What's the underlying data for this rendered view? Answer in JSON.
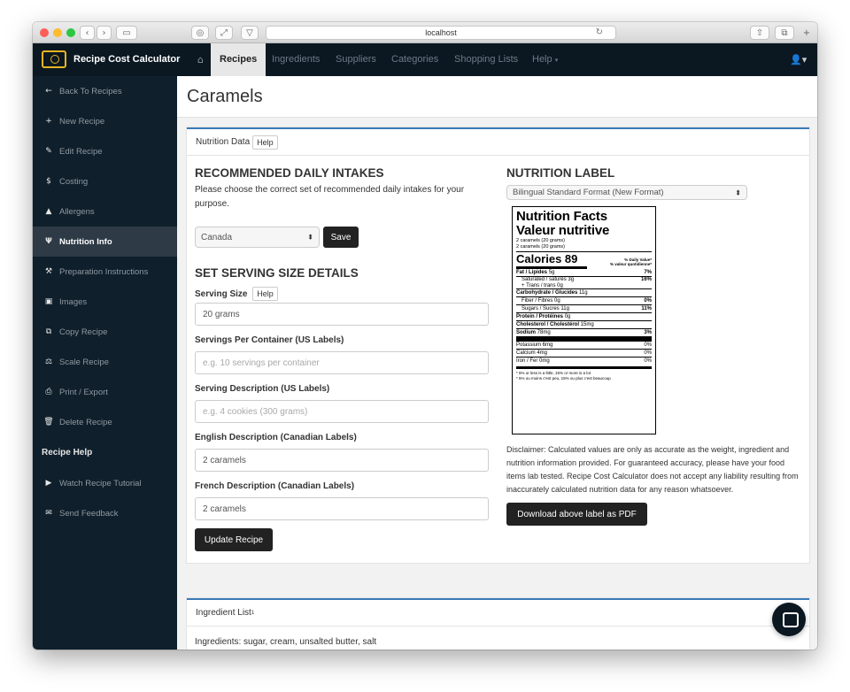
{
  "browser": {
    "url": "localhost"
  },
  "app": {
    "brand": "Recipe Cost Calculator",
    "nav": [
      "Recipes",
      "Ingredients",
      "Suppliers",
      "Categories",
      "Shopping Lists",
      "Help"
    ],
    "user_icon": "user-icon"
  },
  "sidebar": {
    "items": [
      {
        "icon": "←",
        "label": "Back To Recipes"
      },
      {
        "icon": "+",
        "label": "New Recipe"
      },
      {
        "icon": "✎",
        "label": "Edit Recipe"
      },
      {
        "icon": "$",
        "label": "Costing"
      },
      {
        "icon": "▲",
        "label": "Allergens"
      },
      {
        "icon": "Ψ",
        "label": "Nutrition Info"
      },
      {
        "icon": "⚒",
        "label": "Preparation Instructions"
      },
      {
        "icon": "▣",
        "label": "Images"
      },
      {
        "icon": "⧉",
        "label": "Copy Recipe"
      },
      {
        "icon": "⚖",
        "label": "Scale Recipe"
      },
      {
        "icon": "⎙",
        "label": "Print / Export"
      },
      {
        "icon": "🗑",
        "label": "Delete Recipe"
      }
    ],
    "help_heading": "Recipe Help",
    "help_items": [
      {
        "icon": "▶",
        "label": "Watch Recipe Tutorial"
      },
      {
        "icon": "✉",
        "label": "Send Feedback"
      }
    ]
  },
  "page": {
    "title": "Caramels",
    "panel_title": "Nutrition Data",
    "help": "Help",
    "rdi": {
      "heading": "RECOMMENDED DAILY INTAKES",
      "text": "Please choose the correct set of recommended daily intakes for your purpose.",
      "country": "Canada",
      "save": "Save"
    },
    "serving": {
      "heading": "SET SERVING SIZE DETAILS",
      "size_label": "Serving Size",
      "size_value": "20 grams",
      "per_container_label": "Servings Per Container (US Labels)",
      "per_container_ph": "e.g. 10 servings per container",
      "desc_label": "Serving Description (US Labels)",
      "desc_ph": "e.g. 4 cookies (300 grams)",
      "en_label": "English Description (Canadian Labels)",
      "en_value": "2 caramels",
      "fr_label": "French Description (Canadian Labels)",
      "fr_value": "2 caramels",
      "update": "Update Recipe"
    },
    "label_section": {
      "heading": "NUTRITION LABEL",
      "format": "Bilingual Standard Format (New Format)",
      "disclaimer": "Disclaimer: Calculated values are only as accurate as the weight, ingredient and nutrition information provided. For guaranteed accuracy, please have your food items lab tested. Recipe Cost Calculator does not accept any liability resulting from inaccurately calculated nutrition data for any reason whatsoever.",
      "download": "Download above label as PDF"
    },
    "ingredients": {
      "title": "Ingredient List",
      "sup": "1",
      "text": "Ingredients: sugar, cream, unsalted butter, salt"
    }
  },
  "nutrition_facts": {
    "title_en": "Nutrition Facts",
    "title_fr": "Valeur nutritive",
    "serving1": "2 caramels (20 grams)",
    "serving2": "2 caramels (20 grams)",
    "calories": "Calories 89",
    "dv_en": "% Daily Value*",
    "dv_fr": "% valeur quotidienne*",
    "rows": [
      {
        "l": "Fat / Lipides",
        "v": "5g",
        "r": "7%"
      },
      {
        "l": "Saturated / saturés 3g",
        "sub": "+ Trans / trans 0g",
        "r": "16%"
      },
      {
        "l": "Carbohydrate / Glucides",
        "v": "11g",
        "r": ""
      },
      {
        "l": "Fiber / Fibres 0g",
        "r": "0%"
      },
      {
        "l": "Sugars / Sucres 11g",
        "r": "11%"
      },
      {
        "l": "Protein / Protéines",
        "v": "0g",
        "r": ""
      },
      {
        "l": "Cholesterol / Cholestérol",
        "v": "15mg",
        "r": ""
      },
      {
        "l": "Sodium",
        "v": "78mg",
        "r": "3%"
      }
    ],
    "minerals": [
      {
        "l": "Potassium 6mg",
        "r": "0%"
      },
      {
        "l": "Calcium 4mg",
        "r": "0%"
      },
      {
        "l": "Iron / Fer 0mg",
        "r": "0%"
      }
    ],
    "foot1": "* 5% or less is a little, 15% or more is a lot",
    "foot2": "* 5% ou moins c'est peu, 15% ou plus c'est beaucoup"
  }
}
